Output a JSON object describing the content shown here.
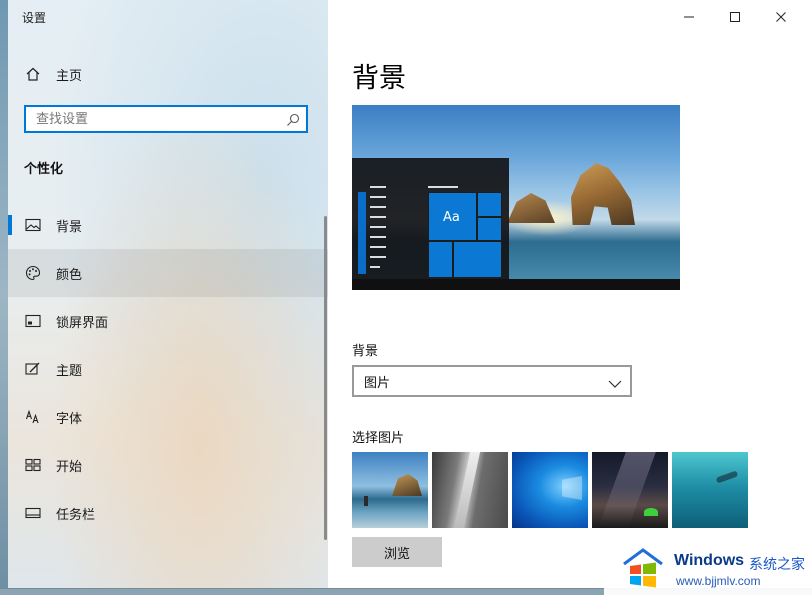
{
  "window": {
    "app_title": "设置",
    "controls": {
      "minimize": "minimize-icon",
      "maximize": "maximize-icon",
      "close": "close-icon"
    }
  },
  "sidebar": {
    "home_label": "主页",
    "search_placeholder": "查找设置",
    "section_title": "个性化",
    "items": [
      {
        "label": "背景",
        "icon": "image-icon",
        "selected": true
      },
      {
        "label": "颜色",
        "icon": "palette-icon"
      },
      {
        "label": "锁屏界面",
        "icon": "lock-screen-icon"
      },
      {
        "label": "主题",
        "icon": "theme-icon"
      },
      {
        "label": "字体",
        "icon": "font-icon"
      },
      {
        "label": "开始",
        "icon": "start-icon"
      },
      {
        "label": "任务栏",
        "icon": "taskbar-icon"
      }
    ]
  },
  "main": {
    "page_title": "背景",
    "preview_tile_label": "Aa",
    "background_label": "背景",
    "background_select_value": "图片",
    "choose_picture_label": "选择图片",
    "browse_label": "浏览"
  },
  "watermark": {
    "brand": "Windows",
    "suffix": "系统之家",
    "url": "www.bjjmlv.com"
  },
  "colors": {
    "accent": "#0078d7"
  }
}
